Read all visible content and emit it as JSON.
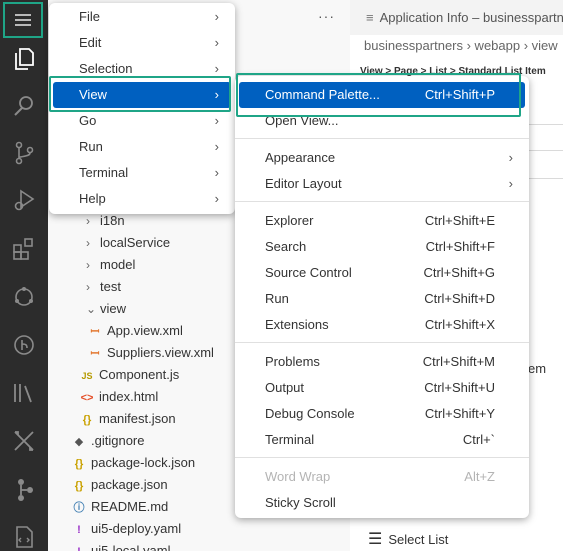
{
  "menu_bar": {
    "items": [
      {
        "label": "File"
      },
      {
        "label": "Edit"
      },
      {
        "label": "Selection"
      },
      {
        "label": "View"
      },
      {
        "label": "Go"
      },
      {
        "label": "Run"
      },
      {
        "label": "Terminal"
      },
      {
        "label": "Help"
      }
    ],
    "active": "View"
  },
  "view_submenu": {
    "items": [
      {
        "label": "Command Palette...",
        "shortcut": "Ctrl+Shift+P"
      },
      {
        "label": "Open View...",
        "shortcut": ""
      },
      {
        "label": "Appearance",
        "shortcut": ""
      },
      {
        "label": "Editor Layout",
        "shortcut": ""
      },
      {
        "label": "Explorer",
        "shortcut": "Ctrl+Shift+E"
      },
      {
        "label": "Search",
        "shortcut": "Ctrl+Shift+F"
      },
      {
        "label": "Source Control",
        "shortcut": "Ctrl+Shift+G"
      },
      {
        "label": "Run",
        "shortcut": "Ctrl+Shift+D"
      },
      {
        "label": "Extensions",
        "shortcut": "Ctrl+Shift+X"
      },
      {
        "label": "Problems",
        "shortcut": "Ctrl+Shift+M"
      },
      {
        "label": "Output",
        "shortcut": "Ctrl+Shift+U"
      },
      {
        "label": "Debug Console",
        "shortcut": "Ctrl+Shift+Y"
      },
      {
        "label": "Terminal",
        "shortcut": "Ctrl+`"
      },
      {
        "label": "Word Wrap",
        "shortcut": "Alt+Z"
      },
      {
        "label": "Sticky Scroll",
        "shortcut": ""
      }
    ]
  },
  "explorer": {
    "more_actions": "···",
    "tree": [
      {
        "label": "i18n",
        "chevron": "›"
      },
      {
        "label": "localService",
        "chevron": "›"
      },
      {
        "label": "model",
        "chevron": "›"
      },
      {
        "label": "test",
        "chevron": "›"
      },
      {
        "label": "view",
        "chevron": "⌄"
      },
      {
        "label": "App.view.xml",
        "icon": "xml-icon",
        "glyph": "ꟷ"
      },
      {
        "label": "Suppliers.view.xml",
        "icon": "xml-icon",
        "glyph": "ꟷ"
      },
      {
        "label": "Component.js",
        "icon": "js-icon",
        "glyph": "JS"
      },
      {
        "label": "index.html",
        "icon": "html-icon",
        "glyph": "<>"
      },
      {
        "label": "manifest.json",
        "icon": "json-icon",
        "glyph": "{}"
      },
      {
        "label": ".gitignore",
        "icon": "git-icon",
        "glyph": "◆"
      },
      {
        "label": "package-lock.json",
        "icon": "json-icon",
        "glyph": "{}"
      },
      {
        "label": "package.json",
        "icon": "json-icon",
        "glyph": "{}"
      },
      {
        "label": "README.md",
        "icon": "markdown-icon",
        "glyph": "ⓘ"
      },
      {
        "label": "ui5-deploy.yaml",
        "icon": "yaml-icon",
        "glyph": "!"
      },
      {
        "label": "ui5-local.yaml",
        "icon": "yaml-icon",
        "glyph": "!"
      }
    ]
  },
  "editor": {
    "tab_title": "Application Info – businesspartn",
    "breadcrumb": "businesspartners  ›  webapp  ›  view",
    "page_title": "View > Page > List > Standard List Item",
    "partial_text": "em",
    "select_list_label": "Select List"
  },
  "colors": {
    "activity_bar": "#2c2c2c",
    "highlight": "#1fa587",
    "menu_active": "#0060c0"
  }
}
